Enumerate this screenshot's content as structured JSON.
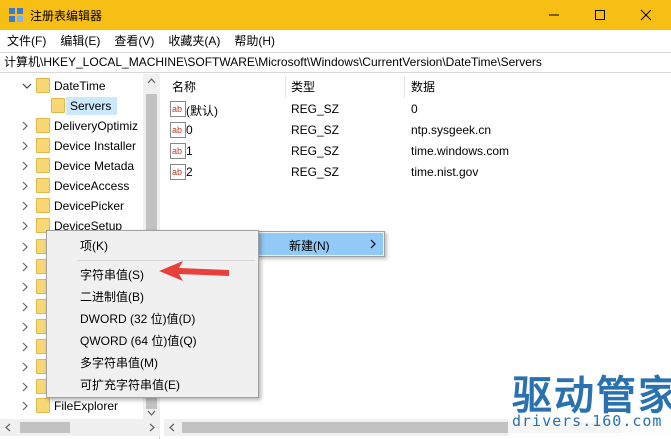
{
  "window": {
    "title": "注册表编辑器"
  },
  "menubar": {
    "items": [
      "文件(F)",
      "编辑(E)",
      "查看(V)",
      "收藏夹(A)",
      "帮助(H)"
    ]
  },
  "address": {
    "path": "计算机\\HKEY_LOCAL_MACHINE\\SOFTWARE\\Microsoft\\Windows\\CurrentVersion\\DateTime\\Servers"
  },
  "tree": {
    "items": [
      {
        "label": "DateTime",
        "expanded": true
      },
      {
        "label": "Servers",
        "selected": true
      },
      {
        "label": "DeliveryOptimiz"
      },
      {
        "label": "Device Installer"
      },
      {
        "label": "Device Metada"
      },
      {
        "label": "DeviceAccess"
      },
      {
        "label": "DevicePicker"
      },
      {
        "label": "DeviceSetup"
      },
      {
        "label": "FileExplorer"
      }
    ]
  },
  "values": {
    "headers": {
      "name": "名称",
      "type": "类型",
      "data": "数据"
    },
    "rows": [
      {
        "name": "(默认)",
        "type": "REG_SZ",
        "data": "0"
      },
      {
        "name": "0",
        "type": "REG_SZ",
        "data": "ntp.sysgeek.cn"
      },
      {
        "name": "1",
        "type": "REG_SZ",
        "data": "time.windows.com"
      },
      {
        "name": "2",
        "type": "REG_SZ",
        "data": "time.nist.gov"
      }
    ]
  },
  "context_menu": {
    "new_label": "新建(N)",
    "items": [
      "项(K)",
      "字符串值(S)",
      "二进制值(B)",
      "DWORD (32 位)值(D)",
      "QWORD (64 位)值(Q)",
      "多字符串值(M)",
      "可扩充字符串值(E)"
    ],
    "highlighted_item": "字符串值(S)"
  },
  "watermark": {
    "title": "驱动管家",
    "url": "drivers.160.com"
  },
  "colors": {
    "titlebar": "#f7bf13",
    "selection": "#cce8ff",
    "menu_hover": "#91c9f7",
    "arrow": "#e8403a",
    "watermark": "#2a71b0"
  }
}
